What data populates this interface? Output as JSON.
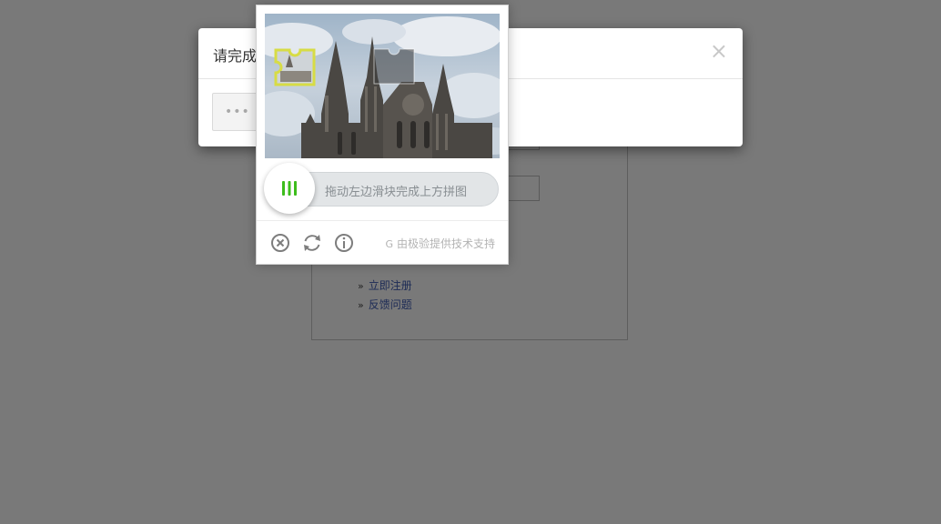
{
  "background_page": {
    "links": [
      {
        "arrow": "»",
        "label": "立即注册"
      },
      {
        "arrow": "»",
        "label": "反馈问题"
      }
    ]
  },
  "modal": {
    "title": "请完成安全验证",
    "close_glyph": "×",
    "trigger_dots": "•••"
  },
  "captcha": {
    "slider_hint": "拖动左边滑块完成上方拼图",
    "brand_text": "由极验提供技术支持",
    "brand_mark": "G",
    "icons": [
      "close-icon",
      "refresh-icon",
      "info-icon"
    ],
    "colors": {
      "knob_bars": "#3dbd1c",
      "track": "#e2e5e7",
      "piece_border": "#d7dc45"
    }
  }
}
